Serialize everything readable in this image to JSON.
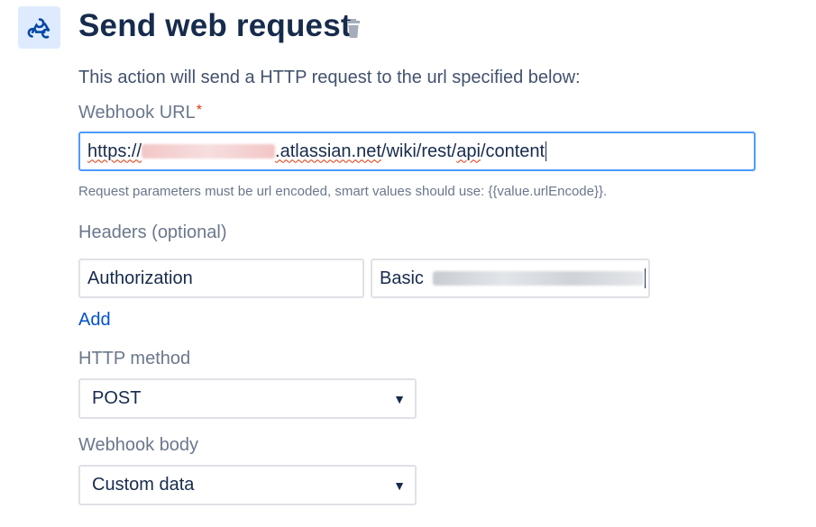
{
  "header": {
    "title": "Send web request",
    "icon": "webhook-icon",
    "delete_icon": "trash-icon"
  },
  "description": "This action will send a HTTP request to the url specified below:",
  "webhook_url": {
    "label": "Webhook URL",
    "required_mark": "*",
    "value_prefix": "https://",
    "value_domain": ".atlassian.net",
    "value_path_a": "/wiki/rest/",
    "value_path_b": "api",
    "value_path_c": "/content",
    "help": "Request parameters must be url encoded, smart values should use: {{value.urlEncode}}."
  },
  "headers": {
    "label": "Headers (optional)",
    "key": "Authorization",
    "value_prefix": "Basic",
    "add_link": "Add"
  },
  "http_method": {
    "label": "HTTP method",
    "selected": "POST"
  },
  "webhook_body": {
    "label": "Webhook body",
    "selected": "Custom data"
  },
  "colors": {
    "accent": "#0052cc",
    "focus_border": "#4c9aff",
    "icon_bg": "#deebff",
    "required": "#de350b"
  }
}
